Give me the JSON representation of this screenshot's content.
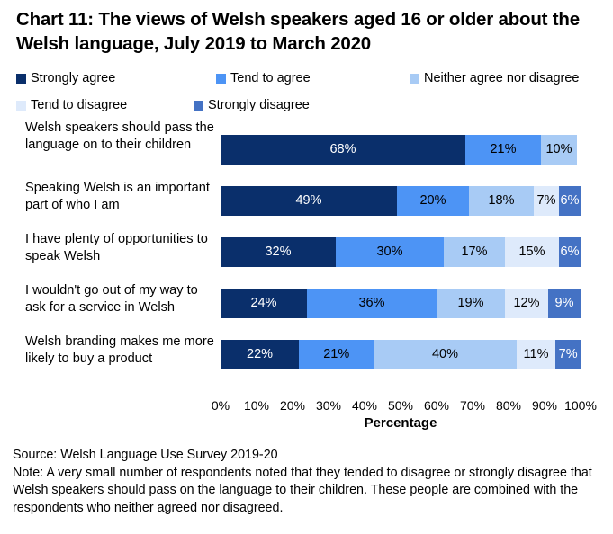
{
  "title": "Chart 11: The views of Welsh speakers aged 16 or older about the Welsh language, July 2019 to March 2020",
  "legend": {
    "items": [
      {
        "label": "Strongly agree",
        "color": "#0A2F6B"
      },
      {
        "label": "Tend to agree",
        "color": "#4D94F5"
      },
      {
        "label": "Neither agree nor disagree",
        "color": "#A8CBF5"
      },
      {
        "label": "Tend to disagree",
        "color": "#DEEAFB"
      },
      {
        "label": "Strongly disagree",
        "color": "#4472C4"
      }
    ]
  },
  "axis": {
    "x_title": "Percentage",
    "ticks": [
      "0%",
      "10%",
      "20%",
      "30%",
      "40%",
      "50%",
      "60%",
      "70%",
      "80%",
      "90%",
      "100%"
    ]
  },
  "notes": {
    "source": "Source: Welsh Language Use Survey 2019-20",
    "note": "Note: A very small number of respondents noted that they tended to disagree or strongly disagree that Welsh speakers should pass on the language to their children. These people are combined with the respondents who neither agreed nor disagreed."
  },
  "chart_data": {
    "type": "bar",
    "orientation": "horizontal",
    "stacked": true,
    "stack_total": 100,
    "title": "Chart 11: The views of Welsh speakers aged 16 or older about the Welsh language, July 2019 to March 2020",
    "xlabel": "Percentage",
    "ylabel": "",
    "xlim": [
      0,
      100
    ],
    "grid": true,
    "legend_position": "top",
    "categories": [
      "Welsh speakers should pass the language on to their children",
      "Speaking Welsh is an important part of who I am",
      "I have plenty of opportunities to speak Welsh",
      "I wouldn't go out of my way to ask for a service in Welsh",
      "Welsh branding makes me more likely to buy a product"
    ],
    "series": [
      {
        "name": "Strongly agree",
        "color": "#0A2F6B",
        "label_color": "#ffffff",
        "values": [
          68,
          49,
          32,
          24,
          22
        ]
      },
      {
        "name": "Tend to agree",
        "color": "#4D94F5",
        "label_color": "#000000",
        "values": [
          21,
          20,
          30,
          36,
          21
        ]
      },
      {
        "name": "Neither agree nor disagree",
        "color": "#A8CBF5",
        "label_color": "#000000",
        "values": [
          10,
          18,
          17,
          19,
          40
        ]
      },
      {
        "name": "Tend to disagree",
        "color": "#DEEAFB",
        "label_color": "#000000",
        "values": [
          0,
          7,
          15,
          12,
          11
        ]
      },
      {
        "name": "Strongly disagree",
        "color": "#4472C4",
        "label_color": "#ffffff",
        "values": [
          0,
          6,
          6,
          9,
          7
        ]
      }
    ],
    "data_labels": [
      [
        "68%",
        "21%",
        "10%",
        "",
        ""
      ],
      [
        "49%",
        "20%",
        "18%",
        "7%",
        "6%"
      ],
      [
        "32%",
        "30%",
        "17%",
        "15%",
        "6%"
      ],
      [
        "24%",
        "36%",
        "19%",
        "12%",
        "9%"
      ],
      [
        "22%",
        "21%",
        "40%",
        "11%",
        "7%"
      ]
    ]
  }
}
